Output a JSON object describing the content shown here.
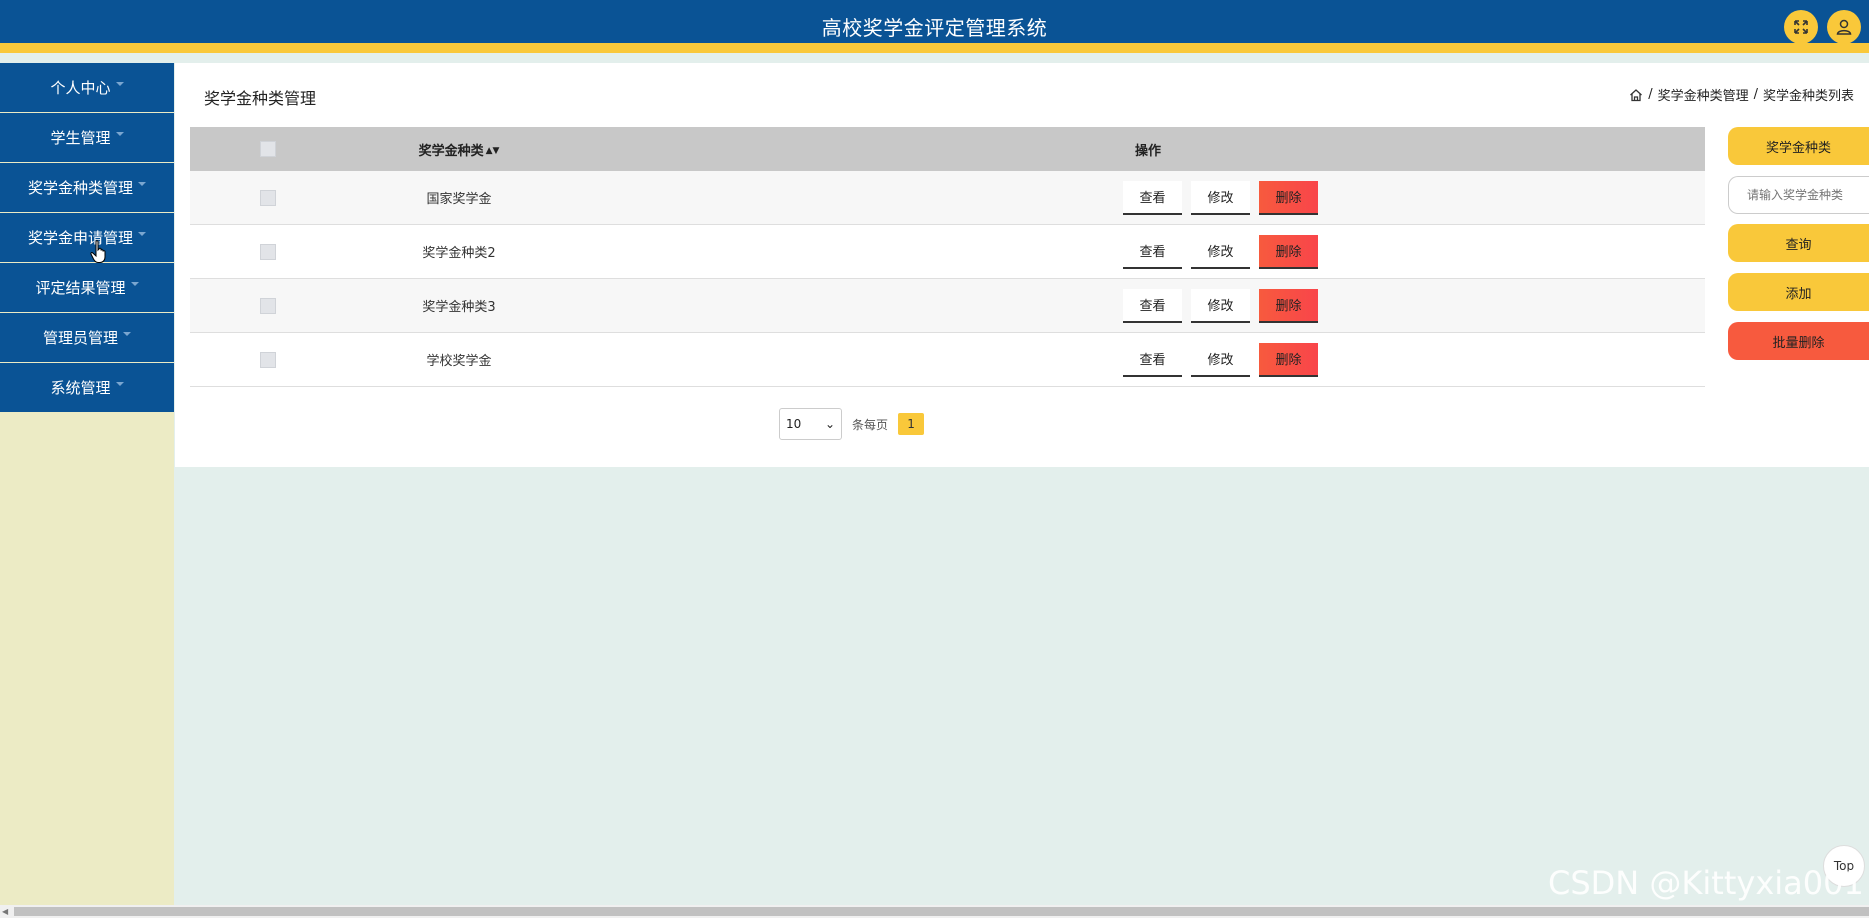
{
  "header": {
    "title": "高校奖学金评定管理系统",
    "fullscreen_icon": "fullscreen-icon",
    "user_icon": "user-icon"
  },
  "sidebar": {
    "items": [
      {
        "label": "个人中心"
      },
      {
        "label": "学生管理"
      },
      {
        "label": "奖学金种类管理"
      },
      {
        "label": "奖学金申请管理"
      },
      {
        "label": "评定结果管理"
      },
      {
        "label": "管理员管理"
      },
      {
        "label": "系统管理"
      }
    ]
  },
  "page": {
    "title": "奖学金种类管理",
    "breadcrumb": {
      "level1": "奖学金种类管理",
      "level2": "奖学金种类列表",
      "sep": "/"
    }
  },
  "table": {
    "headers": {
      "name": "奖学金种类",
      "ops": "操作"
    },
    "rows": [
      {
        "name": "国家奖学金"
      },
      {
        "name": "奖学金种类2"
      },
      {
        "name": "奖学金种类3"
      },
      {
        "name": "学校奖学金"
      }
    ],
    "actions": {
      "view": "查看",
      "edit": "修改",
      "delete": "删除"
    }
  },
  "pagination": {
    "page_size": "10",
    "per_page_label": "条每页",
    "current_page": "1"
  },
  "side_panel": {
    "field_label": "奖学金种类",
    "search_placeholder": "请输入奖学金种类",
    "query": "查询",
    "add": "添加",
    "batch_delete": "批量删除"
  },
  "top_button": "Top",
  "watermark": "CSDN @Kittyxia001",
  "colors": {
    "primary": "#0a5395",
    "accent": "#f9c83a",
    "danger": "#f75a3e",
    "sidebar_bg": "#ecebc5",
    "content_bg": "#e3efec"
  }
}
